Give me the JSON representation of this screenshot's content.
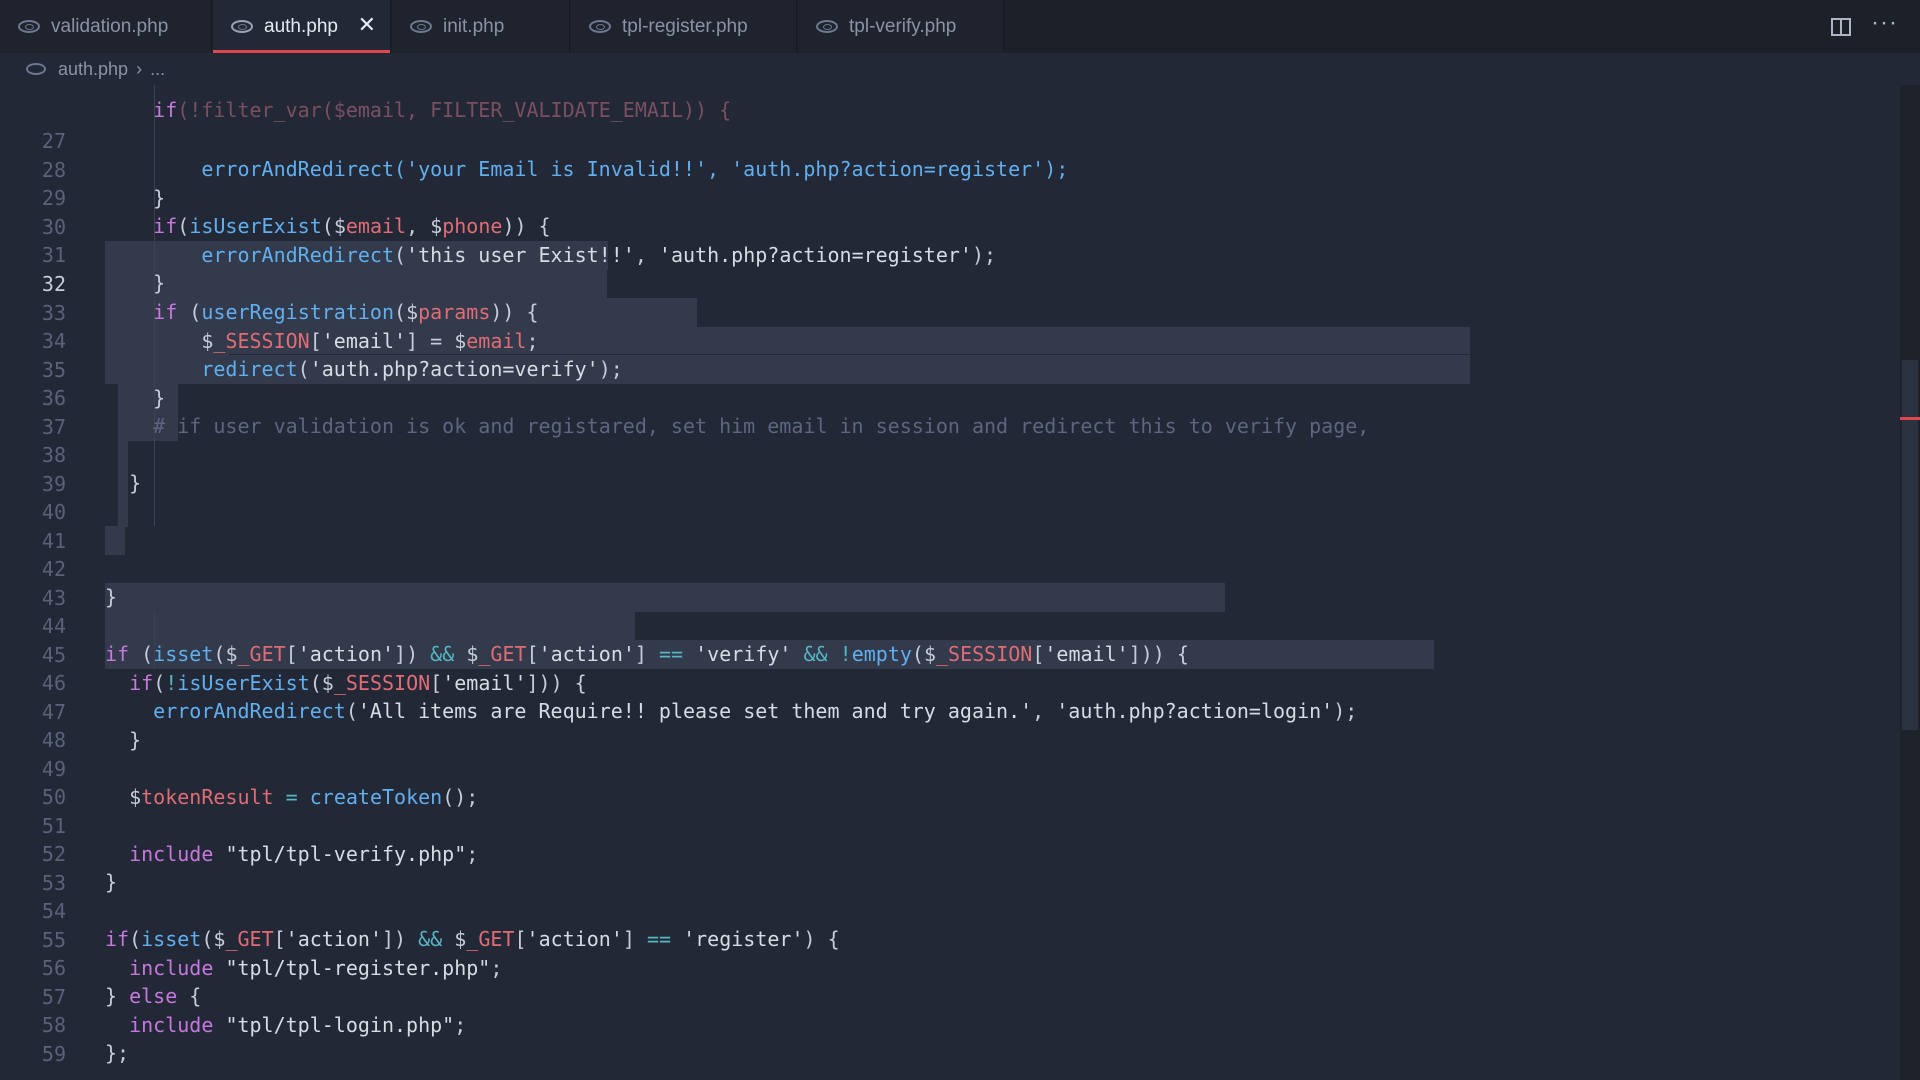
{
  "tabs": [
    {
      "label": "validation.php"
    },
    {
      "label": "auth.php",
      "close": "✕"
    },
    {
      "label": "init.php"
    },
    {
      "label": "tpl-register.php"
    },
    {
      "label": "tpl-verify.php"
    }
  ],
  "toolbar": {
    "more": "···"
  },
  "breadcrumb": {
    "file": "auth.php",
    "separator": "›",
    "rest": "..."
  },
  "editor": {
    "current_line": "32",
    "lines": [
      {
        "n": "27"
      },
      {
        "n": "28"
      },
      {
        "n": "29"
      },
      {
        "n": "30"
      },
      {
        "n": "31"
      },
      {
        "n": "32"
      },
      {
        "n": "33"
      },
      {
        "n": "34"
      },
      {
        "n": "35"
      },
      {
        "n": "36"
      },
      {
        "n": "37"
      },
      {
        "n": "38"
      },
      {
        "n": "39"
      },
      {
        "n": "40"
      },
      {
        "n": "41"
      },
      {
        "n": "42"
      },
      {
        "n": "43"
      },
      {
        "n": "44"
      },
      {
        "n": "45"
      },
      {
        "n": "46"
      },
      {
        "n": "47"
      },
      {
        "n": "48"
      },
      {
        "n": "49"
      },
      {
        "n": "50"
      },
      {
        "n": "51"
      },
      {
        "n": "52"
      },
      {
        "n": "53"
      },
      {
        "n": "54"
      },
      {
        "n": "55"
      },
      {
        "n": "56"
      },
      {
        "n": "57"
      },
      {
        "n": "58"
      },
      {
        "n": "59"
      }
    ],
    "code": {
      "l27": "        errorAndRedirect('your Email is Invalid!!', 'auth.php?action=register');",
      "l28": "    }",
      "l29_a": "if",
      "l29_b": "(",
      "l29_c": "isUserExist",
      "l29_d": "(",
      "l29_e": "$",
      "l29_f": "email",
      "l29_g": ", ",
      "l29_h": "$",
      "l29_i": "phone",
      "l29_j": ")) {",
      "l30_a": "errorAndRedirect",
      "l30_b": "(",
      "l30_c": "'this user Exist!!'",
      "l30_d": ", ",
      "l30_e": "'auth.php?action=register'",
      "l30_f": ");",
      "l31": "}",
      "l32_a": "if",
      "l32_b": " (",
      "l32_c": "userRegistration",
      "l32_d": "(",
      "l32_e": "$",
      "l32_f": "params",
      "l32_g": ")) {",
      "l33_a": "$",
      "l33_b": "_SESSION",
      "l33_c": "[",
      "l33_d": "'email'",
      "l33_e": "] = ",
      "l33_f": "$",
      "l33_g": "email",
      "l33_h": ";",
      "l34_a": "redirect",
      "l34_b": "(",
      "l34_c": "'auth.php?action=verify'",
      "l34_d": ");",
      "l35": "}",
      "l36": "# if user validation is ok and registared, set him email in session and redirect this to verify page,",
      "l38": "}",
      "l42": "}",
      "l44_a": "if",
      "l44_b": " (",
      "l44_c": "isset",
      "l44_d": "(",
      "l44_e": "$",
      "l44_f": "_GET",
      "l44_g": "[",
      "l44_h": "'action'",
      "l44_i": "]) ",
      "l44_j": "&&",
      "l44_k": " ",
      "l44_l": "$",
      "l44_m": "_GET",
      "l44_n": "[",
      "l44_o": "'action'",
      "l44_p": "] ",
      "l44_q": "==",
      "l44_r": " ",
      "l44_s": "'verify'",
      "l44_t": " ",
      "l44_u": "&&",
      "l44_v": " ",
      "l44_w": "!",
      "l44_x": "empty",
      "l44_y": "(",
      "l44_z": "$",
      "l44_aa": "_SESSION",
      "l44_ab": "[",
      "l44_ac": "'email'",
      "l44_ad": "])) {",
      "l45_a": "if",
      "l45_b": "(",
      "l45_c": "!",
      "l45_d": "isUserExist",
      "l45_e": "(",
      "l45_f": "$",
      "l45_g": "_SESSION",
      "l45_h": "[",
      "l45_i": "'email'",
      "l45_j": "])) {",
      "l46_a": "errorAndRedirect",
      "l46_b": "(",
      "l46_c": "'All items are Require!! please set them and try again.'",
      "l46_d": ", ",
      "l46_e": "'auth.php?action=login'",
      "l46_f": ");",
      "l47": "}",
      "l49_a": "$",
      "l49_b": "tokenResult",
      "l49_c": " ",
      "l49_d": "=",
      "l49_e": " ",
      "l49_f": "createToken",
      "l49_g": "();",
      "l51_a": "include",
      "l51_b": " ",
      "l51_c": "\"tpl/tpl-verify.php\"",
      "l51_d": ";",
      "l52": "}",
      "l54_a": "if",
      "l54_b": "(",
      "l54_c": "isset",
      "l54_d": "(",
      "l54_e": "$",
      "l54_f": "_GET",
      "l54_g": "[",
      "l54_h": "'action'",
      "l54_i": "]) ",
      "l54_j": "&&",
      "l54_k": " ",
      "l54_l": "$",
      "l54_m": "_GET",
      "l54_n": "[",
      "l54_o": "'action'",
      "l54_p": "] ",
      "l54_q": "==",
      "l54_r": " ",
      "l54_s": "'register'",
      "l54_t": ") {",
      "l55_a": "include",
      "l55_b": " ",
      "l55_c": "\"tpl/tpl-register.php\"",
      "l55_d": ";",
      "l56_a": "} ",
      "l56_b": "else",
      "l56_c": " {",
      "l57_a": "include",
      "l57_b": " ",
      "l57_c": "\"tpl/tpl-login.php\"",
      "l57_d": ";",
      "l58": "};"
    }
  },
  "colors": {
    "accent": "#e0464e",
    "background": "#222836",
    "keyword": "#c678dd",
    "function": "#61afef",
    "variable": "#e06c75",
    "operator": "#56b6c2"
  }
}
